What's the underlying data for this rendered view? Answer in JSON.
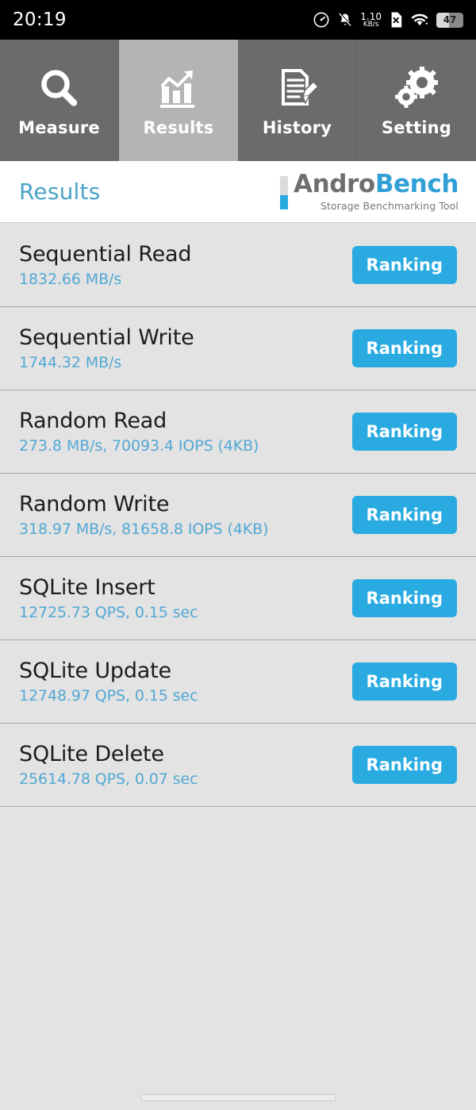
{
  "statusbar": {
    "clock": "20:19",
    "network_speed_value": "1.10",
    "network_speed_unit": "KB/s",
    "battery_percent": "47",
    "icons": [
      "speedometer-icon",
      "notifications-muted-icon",
      "network-speed-icon",
      "sim-card-off-icon",
      "wifi-icon",
      "battery-icon"
    ]
  },
  "tabs": [
    {
      "label": "Measure",
      "icon": "magnifier-icon",
      "active": false
    },
    {
      "label": "Results",
      "icon": "bar-chart-icon",
      "active": true
    },
    {
      "label": "History",
      "icon": "document-pencil-icon",
      "active": false
    },
    {
      "label": "Setting",
      "icon": "gears-icon",
      "active": false
    }
  ],
  "header": {
    "title": "Results",
    "logo_word_1": "Andro",
    "logo_word_2": "Bench",
    "logo_tagline": "Storage Benchmarking Tool"
  },
  "results": [
    {
      "title": "Sequential Read",
      "value": "1832.66 MB/s",
      "button": "Ranking"
    },
    {
      "title": "Sequential Write",
      "value": "1744.32 MB/s",
      "button": "Ranking"
    },
    {
      "title": "Random Read",
      "value": "273.8 MB/s, 70093.4 IOPS (4KB)",
      "button": "Ranking"
    },
    {
      "title": "Random Write",
      "value": "318.97 MB/s, 81658.8 IOPS (4KB)",
      "button": "Ranking"
    },
    {
      "title": "SQLite Insert",
      "value": "12725.73 QPS, 0.15 sec",
      "button": "Ranking"
    },
    {
      "title": "SQLite Update",
      "value": "12748.97 QPS, 0.15 sec",
      "button": "Ranking"
    },
    {
      "title": "SQLite Delete",
      "value": "25614.78 QPS, 0.07 sec",
      "button": "Ranking"
    }
  ],
  "colors": {
    "accent_blue": "#29abe2",
    "value_blue": "#52a8d4",
    "title_blue": "#4aa3c7",
    "tab_inactive": "#6b6b6b",
    "tab_active": "#b4b4b4",
    "list_bg": "#e3e3e3",
    "statusbar_bg": "#000000"
  }
}
